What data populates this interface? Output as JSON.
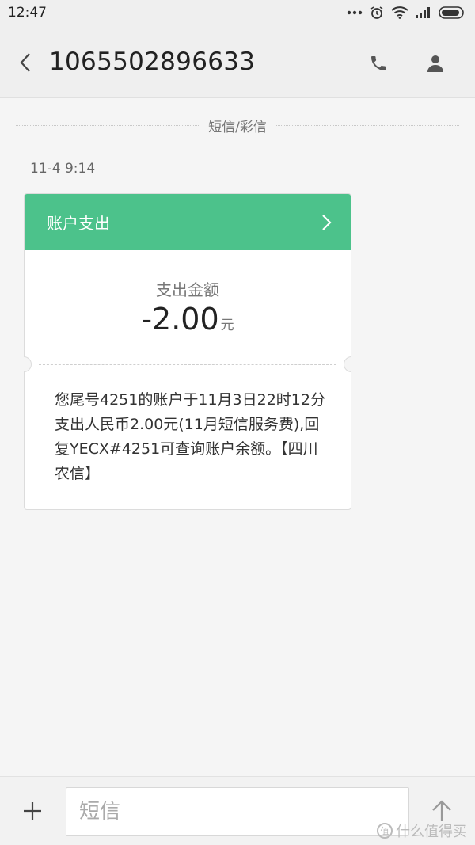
{
  "status_bar": {
    "time": "12:47"
  },
  "header": {
    "contact_number": "1065502896633",
    "back_icon": "chevron-left-icon",
    "call_icon": "phone-icon",
    "profile_icon": "person-icon"
  },
  "conversation": {
    "message_type_label": "短信/彩信",
    "timestamp": "11-4 9:14"
  },
  "card": {
    "title": "账户支出",
    "amount_label": "支出金额",
    "amount": "-2.00",
    "amount_unit": "元",
    "body": "您尾号4251的账户于11月3日22时12分支出人民币2.00元(11月短信服务费),回复YECX#4251可查询账户余额。【四川农信】",
    "header_color": "#4cc28b"
  },
  "compose": {
    "placeholder": "短信",
    "add_icon": "plus-icon",
    "send_icon": "arrow-up-icon"
  },
  "watermark": {
    "text": "什么值得买",
    "icon_text": "值"
  }
}
